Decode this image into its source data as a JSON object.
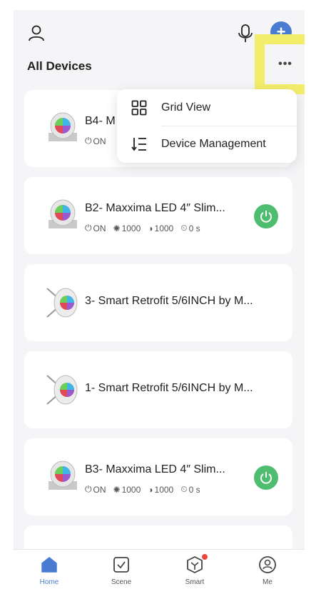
{
  "header": {
    "title": "All Devices",
    "add_symbol": "+",
    "more_symbol": "•••"
  },
  "dropdown": {
    "items": [
      {
        "label": "Grid View",
        "icon": "grid-icon"
      },
      {
        "label": "Device Management",
        "icon": "sort-list-icon"
      }
    ]
  },
  "devices": [
    {
      "name": "B4- M",
      "status": "ON",
      "partial": true,
      "powered": false
    },
    {
      "name": "B2- Maxxima LED 4″ Slim...",
      "status": "ON",
      "brightness": "1000",
      "temperature": "1000",
      "timer": "0 s",
      "powered": true
    },
    {
      "name": "3- Smart Retrofit 5/6INCH by M...",
      "powered": false
    },
    {
      "name": "1- Smart Retrofit 5/6INCH by M...",
      "powered": false
    },
    {
      "name": "B3- Maxxima LED 4″ Slim...",
      "status": "ON",
      "brightness": "1000",
      "temperature": "1000",
      "timer": "0 s",
      "powered": true
    }
  ],
  "tabs": [
    {
      "label": "Home",
      "active": true
    },
    {
      "label": "Scene",
      "active": false
    },
    {
      "label": "Smart",
      "active": false,
      "badge": true
    },
    {
      "label": "Me",
      "active": false
    }
  ],
  "colors": {
    "accent": "#4a7bd3",
    "power_on": "#4fbd6f",
    "highlight": "#f3ee6a",
    "badge": "#e8483e"
  }
}
